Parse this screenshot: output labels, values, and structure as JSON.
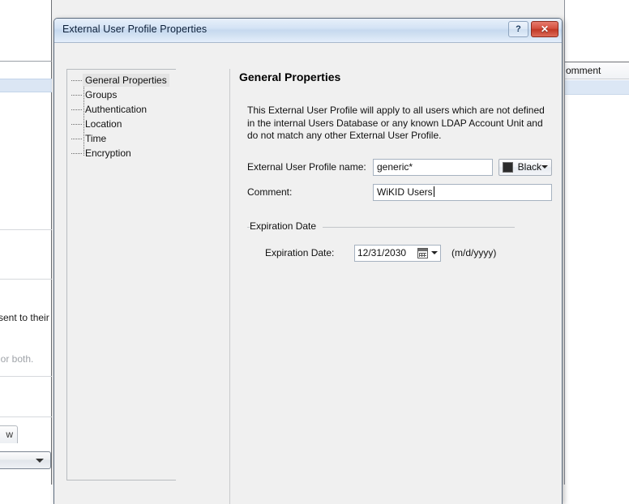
{
  "background": {
    "column_header_fragment": "omment",
    "text_fragment_1": "d sent to their",
    "text_fragment_2": ", or both.",
    "tab_fragment": "w"
  },
  "dialog": {
    "title": "External User Profile Properties",
    "help_button": "?",
    "close_button": "✕",
    "sidebar": {
      "items": [
        {
          "label": "General Properties",
          "selected": true
        },
        {
          "label": "Groups",
          "selected": false
        },
        {
          "label": "Authentication",
          "selected": false
        },
        {
          "label": "Location",
          "selected": false
        },
        {
          "label": "Time",
          "selected": false
        },
        {
          "label": "Encryption",
          "selected": false
        }
      ]
    },
    "content": {
      "page_title": "General Properties",
      "description": "This External User Profile will apply to all users which are not defined\nin the internal Users Database or any known LDAP Account Unit and\ndo not match any other External User Profile.",
      "fields": {
        "name_label": "External User Profile name:",
        "name_value": "generic*",
        "color_value": "Black",
        "color_hex": "#2b2b2b",
        "comment_label": "Comment:",
        "comment_value": "WiKID Users"
      },
      "expiration": {
        "group_title": "Expiration Date",
        "label": "Expiration Date:",
        "value": "12/31/2030",
        "format_hint": "(m/d/yyyy)"
      }
    }
  }
}
